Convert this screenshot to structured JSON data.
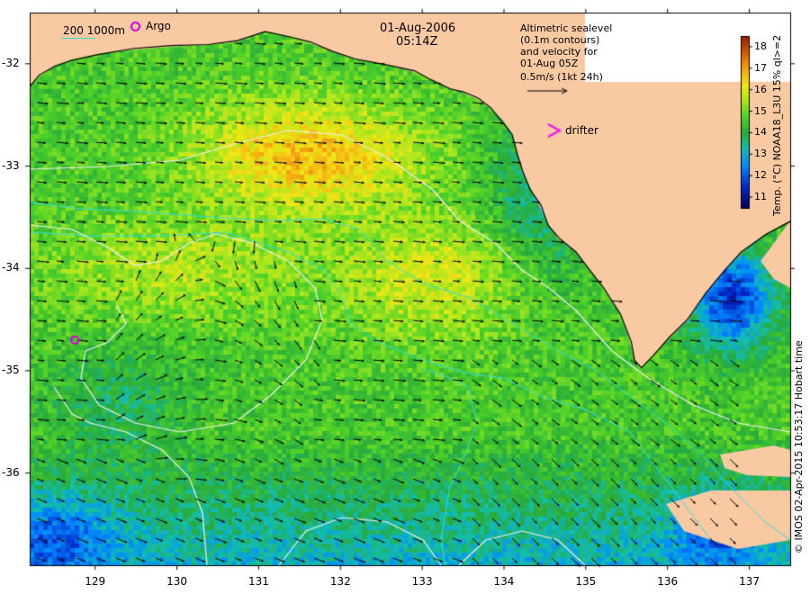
{
  "header": {
    "date": "01-Aug-2006",
    "time": "05:14Z"
  },
  "legend": {
    "isobath_label": "200  1000m",
    "argo_label": "Argo",
    "drifter_label": "drifter",
    "altimetry_lines": [
      "Altimetric sealevel",
      "(0.1m contours)",
      "and velocity for",
      "01-Aug 05Z"
    ],
    "velocity_scale": "0.5m/s (1kt 24h)"
  },
  "axes": {
    "x_ticks": [
      "129",
      "130",
      "131",
      "132",
      "133",
      "134",
      "135",
      "136",
      "137"
    ],
    "y_ticks": [
      "-32",
      "-33",
      "-34",
      "-35",
      "-36"
    ],
    "lon_range": [
      128.2,
      137.5
    ],
    "lat_range": [
      -36.9,
      -31.5
    ]
  },
  "colorbar": {
    "ticks": [
      "18",
      "17",
      "16",
      "15",
      "14",
      "13",
      "12",
      "11"
    ],
    "range": [
      10.5,
      18.5
    ],
    "label": "Temp. (°C) NOAA18_L3U 15% ql>=2"
  },
  "copyright": "© IMOS 02-Apr-2015 10:53:17 Hobart time",
  "argo_float": {
    "lon": 128.75,
    "lat": -34.7
  },
  "colors": {
    "land": "#f9c9a2",
    "isobath_200": "#33dddd",
    "isobath_1000": "#33dddd",
    "sealevel_contour": "#f0f0f0",
    "argo": "#dd00dd",
    "drifter": "#ff00ff"
  }
}
